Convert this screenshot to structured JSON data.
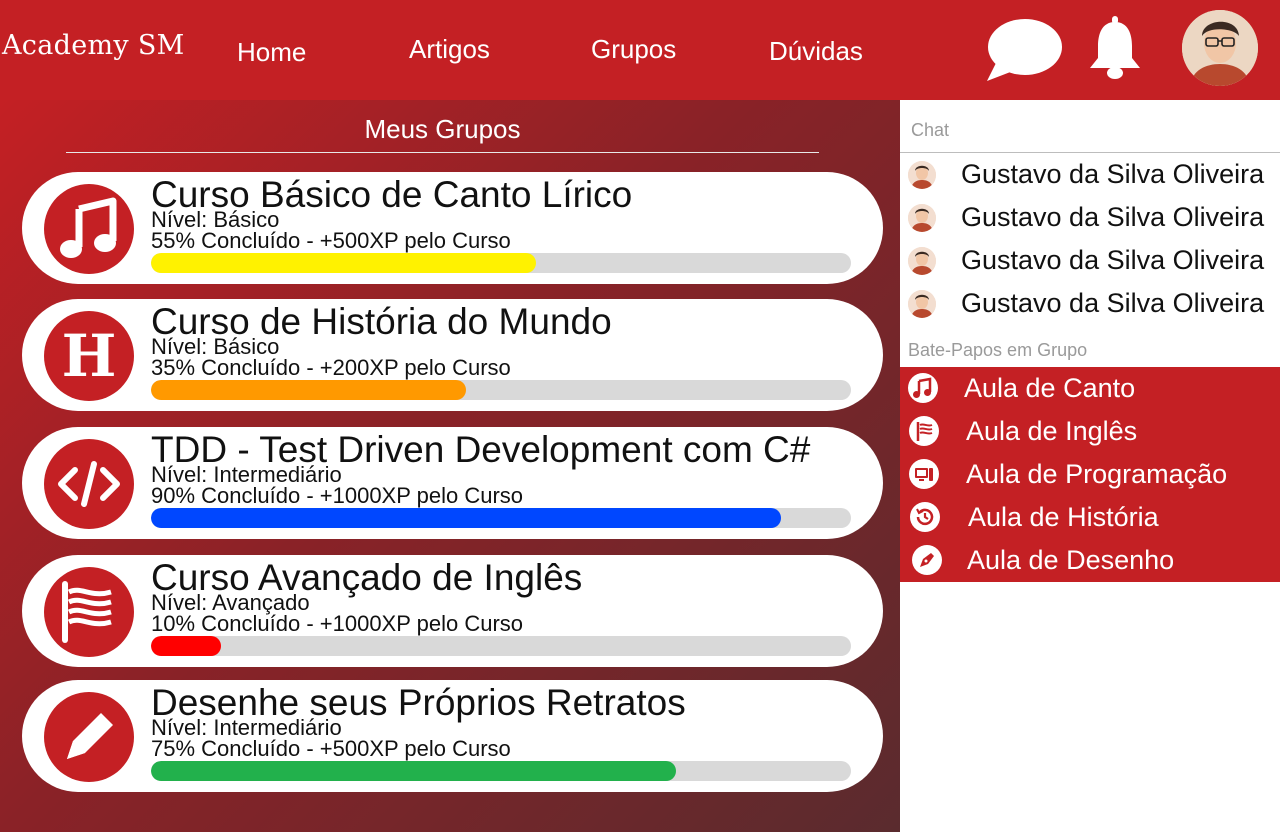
{
  "header": {
    "brand": "Academy SM",
    "nav": {
      "home": "Home",
      "articles": "Artigos",
      "groups": "Grupos",
      "questions": "Dúvidas"
    }
  },
  "main": {
    "title": "Meus Grupos",
    "courses": [
      {
        "title": "Curso Básico de Canto Lírico",
        "level": "Nível: Básico",
        "progress_text": "55% Concluído - +500XP pelo Curso",
        "progress": 0.55,
        "color": "#fff200",
        "icon": "music-note-icon"
      },
      {
        "title": "Curso de História do Mundo",
        "level": "Nível: Básico",
        "progress_text": "35% Concluído - +200XP pelo Curso",
        "progress": 0.45,
        "color": "#ff9900",
        "icon": "letter-h-icon"
      },
      {
        "title": "TDD - Test Driven Development com C#",
        "level": "Nível: Intermediário",
        "progress_text": "90% Concluído - +1000XP pelo Curso",
        "progress": 0.9,
        "color": "#0047ff",
        "icon": "code-icon"
      },
      {
        "title": "Curso Avançado de Inglês",
        "level": "Nível: Avançado",
        "progress_text": "10% Concluído - +1000XP pelo Curso",
        "progress": 0.1,
        "color": "#ff0000",
        "icon": "flag-icon"
      },
      {
        "title": "Desenhe seus Próprios Retratos",
        "level": "Nível: Intermediário",
        "progress_text": "75% Concluído - +500XP pelo Curso",
        "progress": 0.75,
        "color": "#22b14c",
        "icon": "pencil-icon"
      }
    ]
  },
  "sidebar": {
    "chat_label": "Chat",
    "contacts": [
      {
        "name": "Gustavo da Silva Oliveira"
      },
      {
        "name": "Gustavo da Silva Oliveira"
      },
      {
        "name": "Gustavo da Silva Oliveira"
      },
      {
        "name": "Gustavo da Silva Oliveira"
      }
    ],
    "group_chats_label": "Bate-Papos em Grupo",
    "group_chats": [
      {
        "name": "Aula de Canto",
        "icon": "music-note-icon"
      },
      {
        "name": "Aula de Inglês",
        "icon": "flag-icon"
      },
      {
        "name": "Aula de Programação",
        "icon": "computer-icon"
      },
      {
        "name": "Aula de História",
        "icon": "history-icon"
      },
      {
        "name": "Aula de Desenho",
        "icon": "pen-nib-icon"
      }
    ]
  },
  "colors": {
    "brand": "#c42024",
    "panel_gradient_end": "#5a2b2e",
    "track": "#d9d9d9"
  }
}
